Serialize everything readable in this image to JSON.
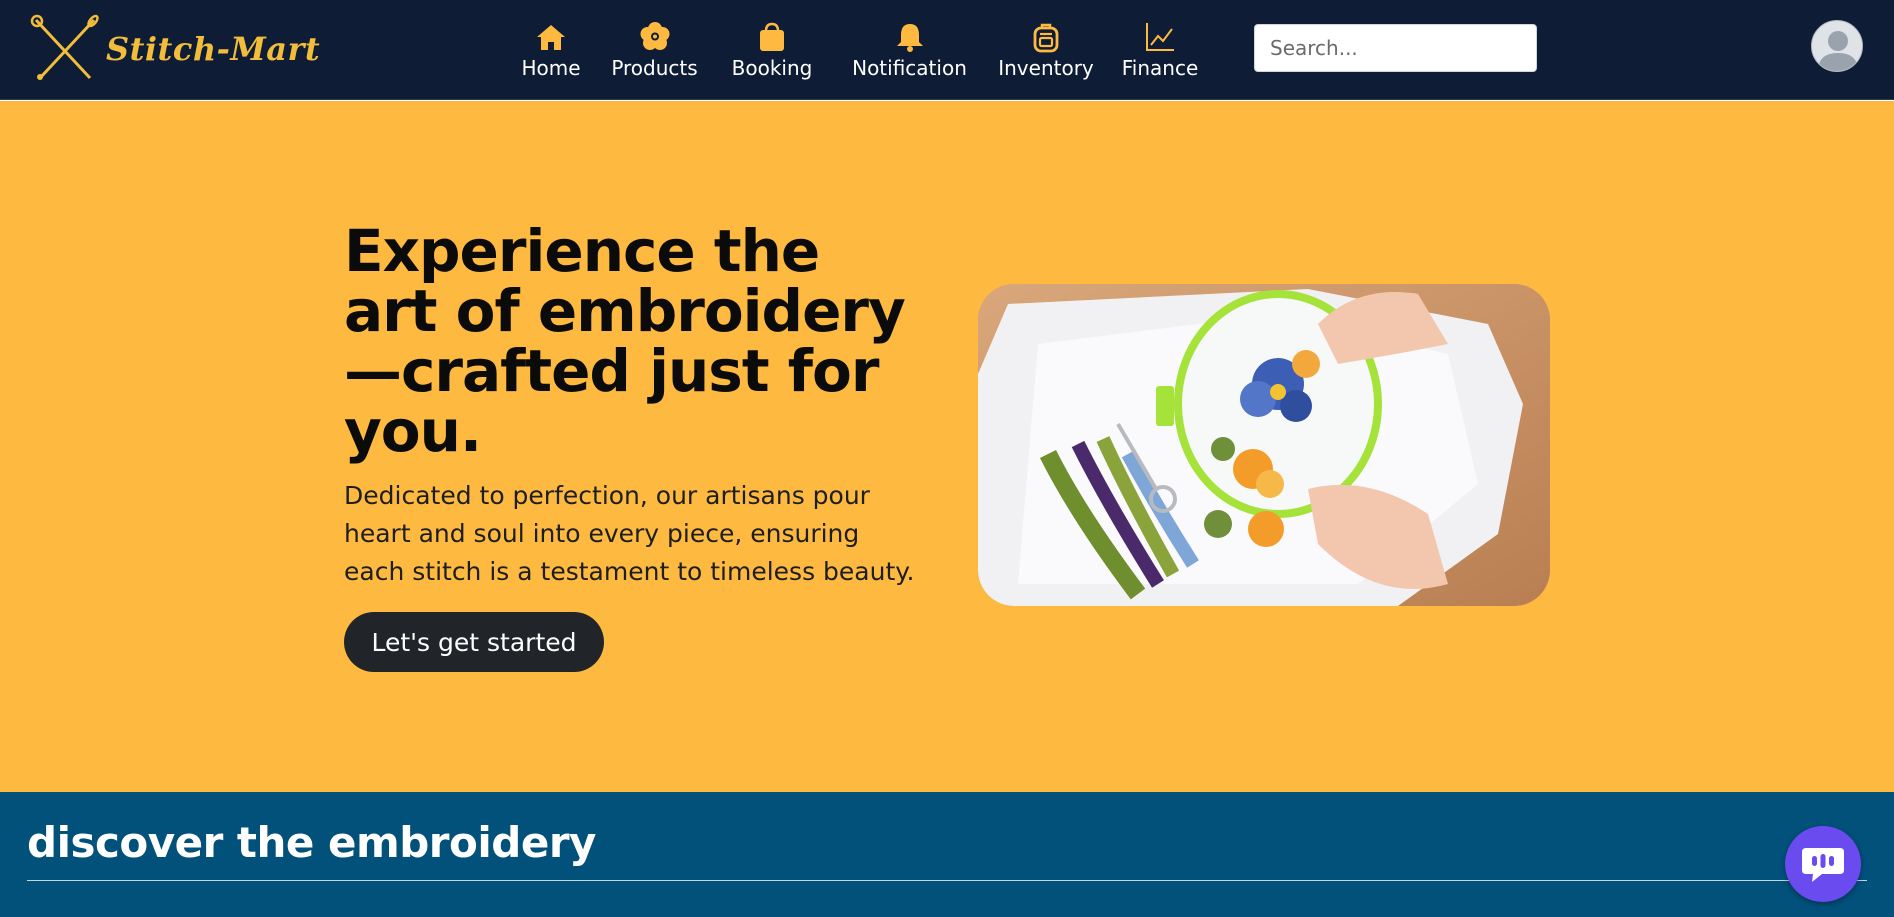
{
  "brand": {
    "name": "Stitch-Mart",
    "accent": "#f2bd3a",
    "nav_bg": "#0e1c36"
  },
  "nav": {
    "items": [
      {
        "label": "Home",
        "icon": "home-icon"
      },
      {
        "label": "Products",
        "icon": "flower-icon"
      },
      {
        "label": "Booking",
        "icon": "shopping-bag-icon"
      },
      {
        "label": "Notification",
        "icon": "bell-icon"
      },
      {
        "label": "Inventory",
        "icon": "backpack-icon"
      },
      {
        "label": "Finance",
        "icon": "chart-line-icon"
      }
    ],
    "search_placeholder": "Search..."
  },
  "user": {
    "avatar_icon": "user-avatar-icon"
  },
  "hero": {
    "title": "Experience the art of embroidery—crafted just for you.",
    "description": "Dedicated to perfection, our artisans pour heart and soul into every piece, ensuring each stitch is a testament to timeless beauty.",
    "cta_label": "Let's get started",
    "bg": "#fdb940"
  },
  "discover": {
    "title": "discover the embroidery",
    "bg": "#02517b"
  },
  "chat": {
    "icon": "chat-bubble-icon",
    "color": "#6a4bf0"
  }
}
